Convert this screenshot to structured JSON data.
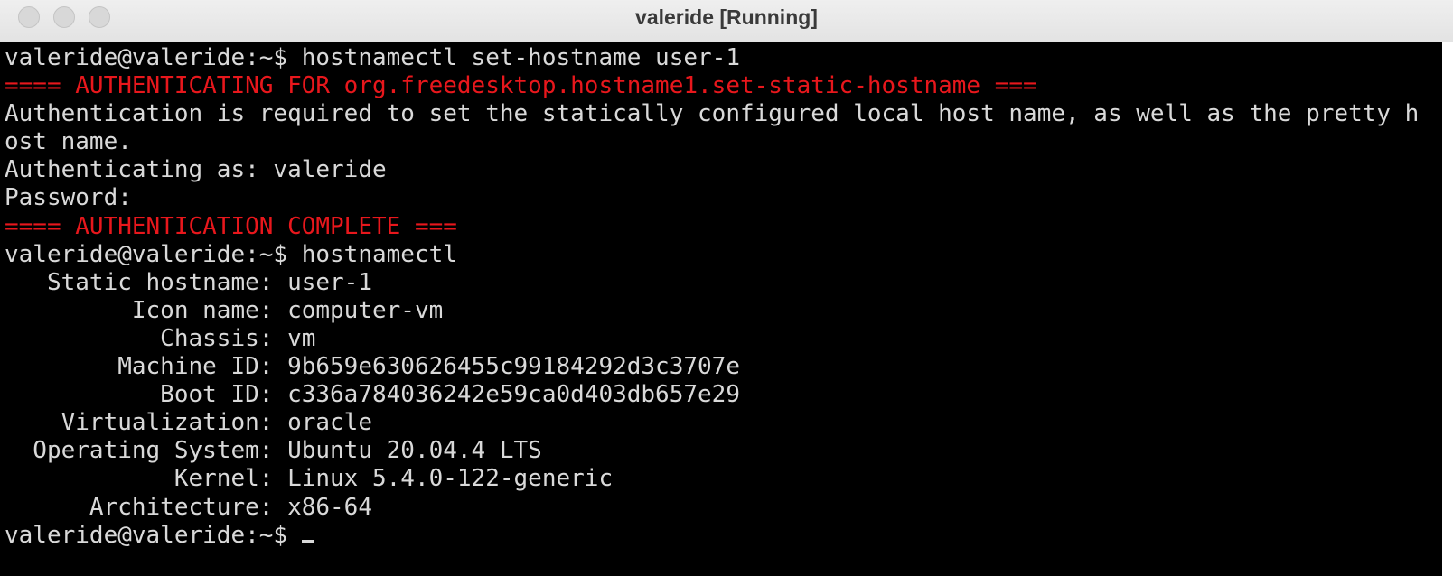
{
  "window": {
    "title": "valeride [Running]"
  },
  "terminal": {
    "prompt": "valeride@valeride:~$ ",
    "lines": [
      "valeride@valeride:~$ hostnamectl set-hostname user-1",
      "==== AUTHENTICATING FOR org.freedesktop.hostname1.set-static-hostname ===",
      "Authentication is required to set the statically configured local host name, as well as the pretty h",
      "ost name.",
      "Authenticating as: valeride",
      "Password:",
      "==== AUTHENTICATION COMPLETE ===",
      "valeride@valeride:~$ hostnamectl",
      "   Static hostname: user-1",
      "         Icon name: computer-vm",
      "           Chassis: vm",
      "        Machine ID: 9b659e630626455c99184292d3c3707e",
      "           Boot ID: c336a784036242e59ca0d403db657e29",
      "    Virtualization: oracle",
      "  Operating System: Ubuntu 20.04.4 LTS",
      "            Kernel: Linux 5.4.0-122-generic",
      "      Architecture: x86-64"
    ]
  },
  "colors": {
    "foreground": "#d9d9d9",
    "alert_red": "#e8171c",
    "background": "#000000"
  }
}
